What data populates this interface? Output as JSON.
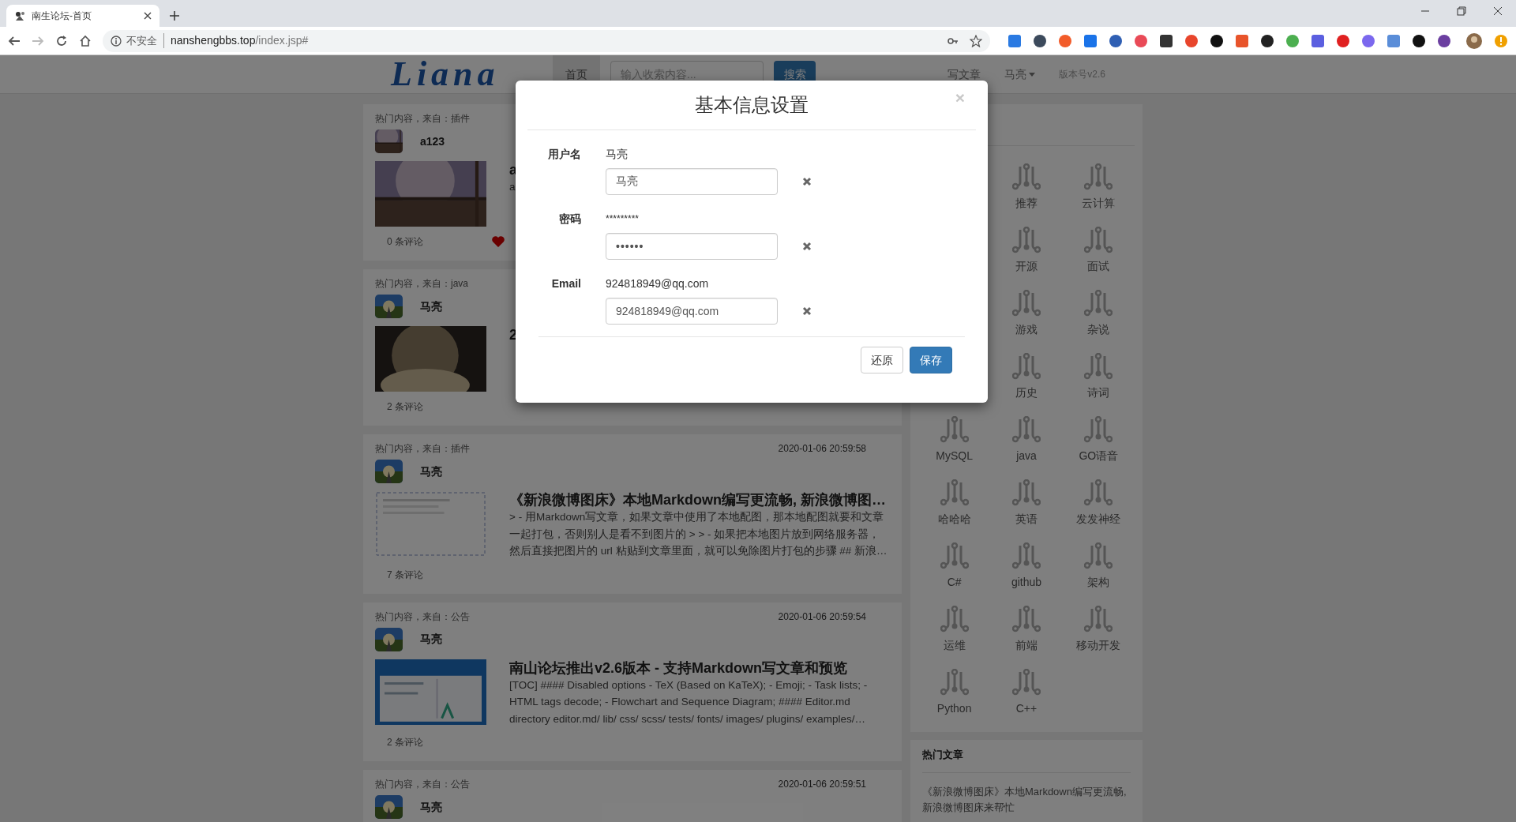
{
  "browser": {
    "tab_title": "南生论坛-首页",
    "security": "不安全",
    "url_host": "nanshengbbs.top",
    "url_path": "/index.jsp#"
  },
  "navbar": {
    "logo": "Liana",
    "nav": [
      {
        "label": "首页",
        "selected": true
      }
    ],
    "search": {
      "placeholder": "输入收索内容...",
      "button": "搜索"
    },
    "right": [
      {
        "label": "写文章",
        "kind": "link"
      },
      {
        "label": "马亮",
        "kind": "dropdown"
      },
      {
        "label": "版本号v2.6",
        "kind": "text"
      }
    ]
  },
  "posts": [
    {
      "source": "热门内容，来自：插件",
      "author": "a123",
      "title": "a",
      "excerpt": [
        "a"
      ],
      "comments": "0 条评论",
      "liked": true
    },
    {
      "source": "热门内容，来自：java",
      "author": "马亮",
      "title": "2",
      "comments": "2 条评论",
      "liked": false
    },
    {
      "source": "热门内容，来自：插件",
      "date": "2020-01-06 20:59:58",
      "author": "马亮",
      "title": "《新浪微博图床》本地Markdown编写更流畅, 新浪微博图…",
      "excerpt": [
        "> - 用Markdown写文章，如果文章中使用了本地配图，那本地配图就要和文章",
        "一起打包，否则别人是看不到图片的 > > - 如果把本地图片放到网络服务器，",
        "然后直接把图片的 url 粘贴到文章里面，就可以免除图片打包的步骤 ## 新浪…"
      ],
      "comments": "7 条评论",
      "liked": false
    },
    {
      "source": "热门内容，来自：公告",
      "date": "2020-01-06 20:59:54",
      "author": "马亮",
      "title": "南山论坛推出v2.6版本 - 支持Markdown写文章和预览",
      "excerpt": [
        "[TOC] #### Disabled options - TeX (Based on KaTeX); - Emoji; - Task lists; -",
        "HTML tags decode; - Flowchart and Sequence Diagram; #### Editor.md",
        "directory editor.md/ lib/ css/ scss/ tests/ fonts/ images/ plugins/ examples/…"
      ],
      "comments": "2 条评论",
      "liked": false
    },
    {
      "source": "热门内容，来自：公告",
      "date": "2020-01-06 20:59:51",
      "author": "马亮"
    }
  ],
  "tag_panel": {
    "rows": [
      {
        "covered_start": true,
        "tags": [
          "推荐",
          "云计算"
        ]
      },
      {
        "covered_start": true,
        "tags": [
          "开源",
          "面试"
        ]
      },
      {
        "covered_start": true,
        "tags": [
          "游戏",
          "杂说"
        ]
      },
      {
        "covered_start": true,
        "tags": [
          "历史",
          "诗词"
        ]
      },
      {
        "covered_start": false,
        "tags": [
          "MySQL",
          "java",
          "GO语音"
        ]
      },
      {
        "covered_start": false,
        "tags": [
          "哈哈哈",
          "英语",
          "发发神经"
        ]
      },
      {
        "covered_start": false,
        "tags": [
          "C#",
          "github",
          "架构"
        ]
      },
      {
        "covered_start": false,
        "tags": [
          "运维",
          "前端",
          "移动开发"
        ]
      },
      {
        "covered_start": false,
        "tags": [
          "Python",
          "C++"
        ]
      }
    ]
  },
  "hot_articles": {
    "title": "热门文章",
    "items": [
      "《新浪微博图床》本地Markdown编写更流畅, 新浪微博图床来帮忙"
    ]
  },
  "modal": {
    "title": "基本信息设置",
    "close": "×",
    "fields": [
      {
        "label": "用户名",
        "current": "马亮",
        "value": "马亮",
        "kind": "text"
      },
      {
        "label": "密码",
        "current": "*********",
        "value": "••••••",
        "kind": "password"
      },
      {
        "label": "Email",
        "current": "924818949@qq.com",
        "value": "924818949@qq.com",
        "kind": "text"
      }
    ],
    "buttons": [
      {
        "label": "还原",
        "kind": "default"
      },
      {
        "label": "保存",
        "kind": "primary"
      }
    ]
  }
}
